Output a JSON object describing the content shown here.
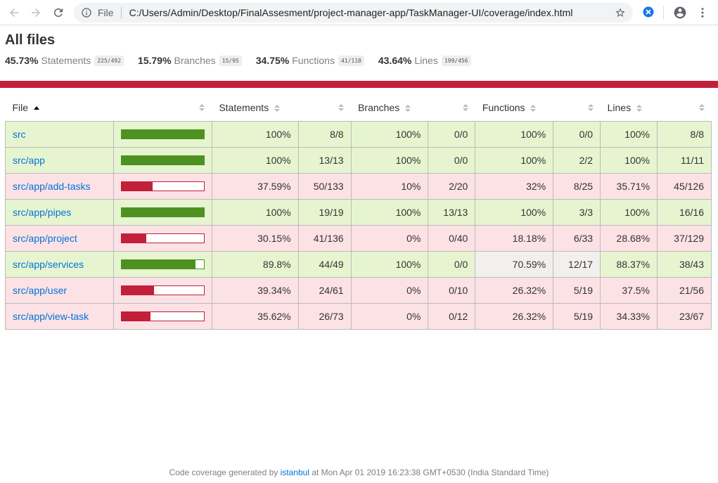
{
  "browser": {
    "file_label": "File",
    "url": "C:/Users/Admin/Desktop/FinalAssesment/project-manager-app/TaskManager-UI/coverage/index.html"
  },
  "page": {
    "title": "All files",
    "summary": [
      {
        "pct": "45.73%",
        "label": "Statements",
        "fraction": "225/492"
      },
      {
        "pct": "15.79%",
        "label": "Branches",
        "fraction": "15/95"
      },
      {
        "pct": "34.75%",
        "label": "Functions",
        "fraction": "41/118"
      },
      {
        "pct": "43.64%",
        "label": "Lines",
        "fraction": "199/456"
      }
    ]
  },
  "table": {
    "headers": {
      "file": "File",
      "statements": "Statements",
      "branches": "Branches",
      "functions": "Functions",
      "lines": "Lines"
    },
    "rows": [
      {
        "file": "src",
        "cls": "high",
        "bar": 100,
        "st_pct": "100%",
        "st_frac": "8/8",
        "br_pct": "100%",
        "br_frac": "0/0",
        "fn_pct": "100%",
        "fn_frac": "0/0",
        "ln_pct": "100%",
        "ln_frac": "8/8"
      },
      {
        "file": "src/app",
        "cls": "high",
        "bar": 100,
        "st_pct": "100%",
        "st_frac": "13/13",
        "br_pct": "100%",
        "br_frac": "0/0",
        "fn_pct": "100%",
        "fn_frac": "2/2",
        "ln_pct": "100%",
        "ln_frac": "11/11"
      },
      {
        "file": "src/app/add-tasks",
        "cls": "low",
        "bar": 37.59,
        "st_pct": "37.59%",
        "st_frac": "50/133",
        "br_pct": "10%",
        "br_frac": "2/20",
        "fn_pct": "32%",
        "fn_frac": "8/25",
        "ln_pct": "35.71%",
        "ln_frac": "45/126"
      },
      {
        "file": "src/app/pipes",
        "cls": "high",
        "bar": 100,
        "st_pct": "100%",
        "st_frac": "19/19",
        "br_pct": "100%",
        "br_frac": "13/13",
        "fn_pct": "100%",
        "fn_frac": "3/3",
        "ln_pct": "100%",
        "ln_frac": "16/16"
      },
      {
        "file": "src/app/project",
        "cls": "low",
        "bar": 30.15,
        "st_pct": "30.15%",
        "st_frac": "41/136",
        "br_pct": "0%",
        "br_frac": "0/40",
        "fn_pct": "18.18%",
        "fn_frac": "6/33",
        "ln_pct": "28.68%",
        "ln_frac": "37/129"
      },
      {
        "file": "src/app/services",
        "cls": "high",
        "bar": 89.8,
        "st_pct": "89.8%",
        "st_frac": "44/49",
        "br_pct": "100%",
        "br_frac": "0/0",
        "fn_pct": "70.59%",
        "fn_frac": "12/17",
        "fn_medium": true,
        "ln_pct": "88.37%",
        "ln_frac": "38/43"
      },
      {
        "file": "src/app/user",
        "cls": "low",
        "bar": 39.34,
        "st_pct": "39.34%",
        "st_frac": "24/61",
        "br_pct": "0%",
        "br_frac": "0/10",
        "fn_pct": "26.32%",
        "fn_frac": "5/19",
        "ln_pct": "37.5%",
        "ln_frac": "21/56"
      },
      {
        "file": "src/app/view-task",
        "cls": "low",
        "bar": 35.62,
        "st_pct": "35.62%",
        "st_frac": "26/73",
        "br_pct": "0%",
        "br_frac": "0/12",
        "fn_pct": "26.32%",
        "fn_frac": "5/19",
        "ln_pct": "34.33%",
        "ln_frac": "23/67"
      }
    ]
  },
  "footer": {
    "prefix": "Code coverage generated by",
    "link": "istanbul",
    "suffix": "at Mon Apr 01 2019 16:23:38 GMT+0530 (India Standard Time)"
  },
  "colors": {
    "low": "#c21f39",
    "high": "#4d9221",
    "link": "#0074d9"
  }
}
